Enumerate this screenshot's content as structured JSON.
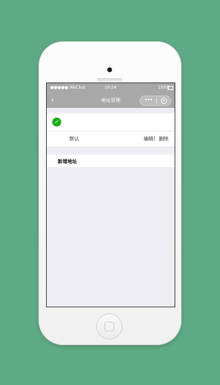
{
  "status_bar": {
    "carrier": "●●●●● WeChat",
    "time": "10:24",
    "battery": "100%"
  },
  "nav": {
    "back_icon": "chevron-left-icon",
    "title": "地址管理",
    "capsule_more_icon": "more-dots-icon",
    "capsule_close_icon": "target-icon"
  },
  "address_card": {
    "check_icon": "check-circle-icon",
    "default_label": "默认",
    "edit_label": "编辑",
    "separator": "|",
    "delete_label": "删除"
  },
  "add_address": {
    "label": "新增地址"
  },
  "colors": {
    "background": "#5faa86",
    "accent_green": "#1aad19",
    "navbar": "#a8a8a8",
    "page_bg": "#ededf2"
  }
}
